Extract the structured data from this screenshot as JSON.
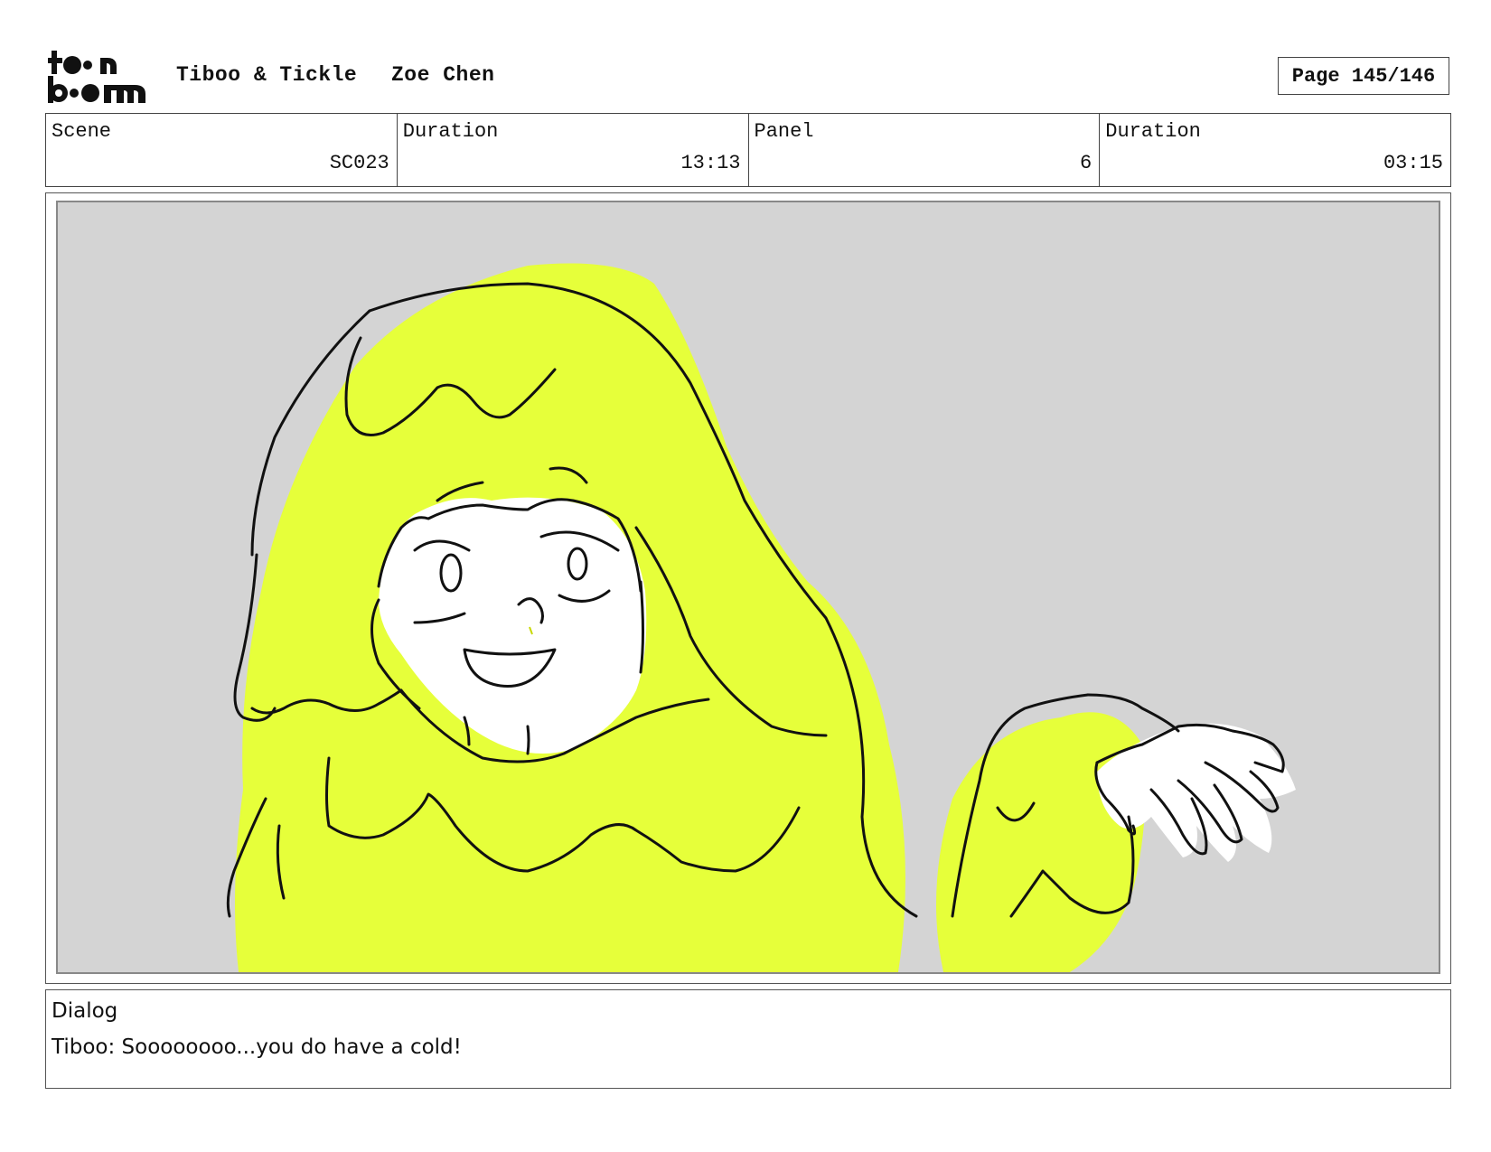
{
  "header": {
    "logo_text": "toon boom",
    "project": "Tiboo & Tickle",
    "author": "Zoe Chen",
    "page": "Page 145/146"
  },
  "info": {
    "scene_label": "Scene",
    "scene_value": "SC023",
    "scene_duration_label": "Duration",
    "scene_duration_value": "13:13",
    "panel_label": "Panel",
    "panel_value": "6",
    "panel_duration_label": "Duration",
    "panel_duration_value": "03:15"
  },
  "dialog": {
    "label": "Dialog",
    "text": "Tiboo: Soooooooo...you do have a cold!"
  },
  "colors": {
    "hair_fill": "#e6ff3a",
    "panel_bg": "#d4d4d4",
    "line": "#111111"
  }
}
